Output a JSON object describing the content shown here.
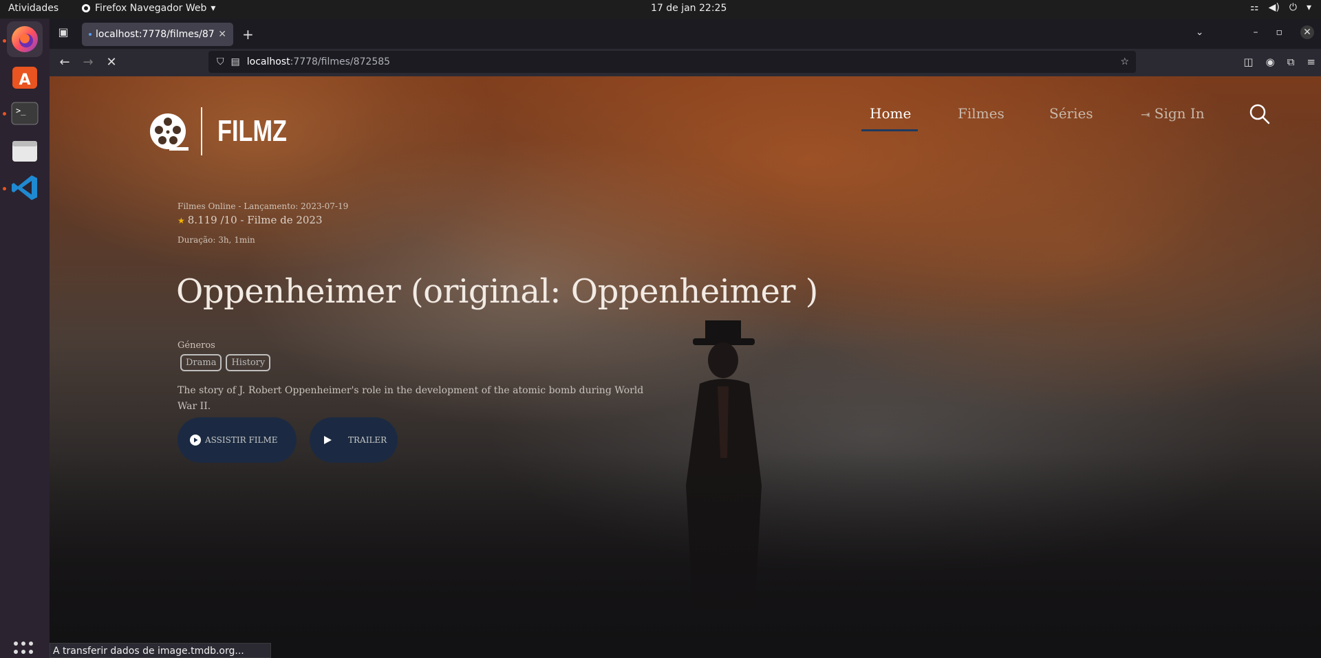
{
  "system": {
    "activities": "Atividades",
    "app_name": "Firefox Navegador Web",
    "clock": "17 de jan  22:25"
  },
  "browser": {
    "tab_title": "localhost:7778/filmes/87",
    "url_host": "localhost",
    "url_path": ":7778/filmes/872585",
    "status_text": "A transferir dados de image.tmdb.org..."
  },
  "site": {
    "logo_text": "FILMZ",
    "nav": {
      "home": "Home",
      "movies": "Filmes",
      "series": "Séries",
      "signin": "Sign In"
    }
  },
  "movie": {
    "meta": "Filmes Online - Lançamento: 2023-07-19",
    "rating_text": "8.119 /10 - Filme de 2023",
    "duration": "Duração: 3h, 1min",
    "title": "Oppenheimer (original: Oppenheimer )",
    "genres_label": "Géneros",
    "genres": [
      "Drama",
      "History"
    ],
    "overview": "The story of J. Robert Oppenheimer's role in the development of the atomic bomb during World War II.",
    "watch_label": "ASSISTIR FILME",
    "trailer_label": "TRAILER"
  },
  "colors": {
    "accent": "#1e3a5f",
    "button_bg": "#1b2a42",
    "star": "#f5b700"
  }
}
